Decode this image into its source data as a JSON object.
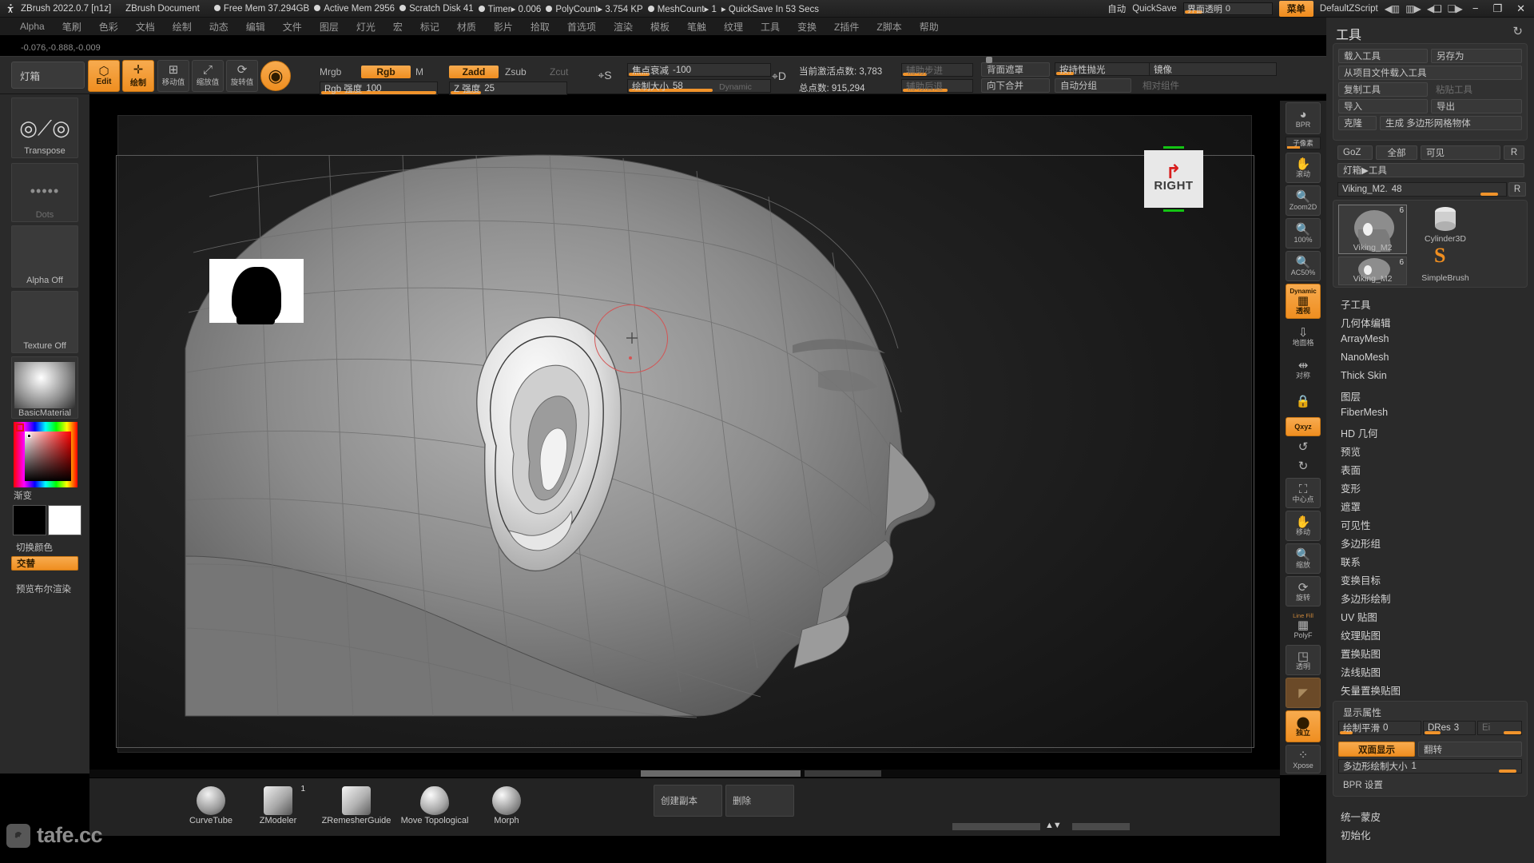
{
  "titlebar": {
    "app_icon": "zbrush-logo-icon",
    "app_name": "ZBrush 2022.0.7 [n1z]",
    "document": "ZBrush Document",
    "stats": [
      "Free Mem 37.294GB",
      "Active Mem 2956",
      "Scratch Disk 41",
      "Timer▸ 0.006",
      "PolyCount▸ 3.754 KP",
      "MeshCount▸ 1"
    ],
    "quicksave_status": "▸ QuickSave In 53 Secs",
    "auto_label": "自动",
    "quicksave_label": "QuickSave",
    "ui_transparency_label": "界面透明",
    "ui_transparency_value": "0",
    "menu_button": "菜单",
    "zscript": "DefaultZScript",
    "window_buttons": [
      "−",
      "❐",
      "✕"
    ]
  },
  "menubar": {
    "items": [
      "Alpha",
      "笔刷",
      "色彩",
      "文档",
      "绘制",
      "动态",
      "编辑",
      "文件",
      "图层",
      "灯光",
      "宏",
      "标记",
      "材质",
      "影片",
      "拾取",
      "首选项",
      "渲染",
      "模板",
      "笔触",
      "纹理",
      "工具",
      "变换",
      "Z插件",
      "Z脚本",
      "帮助"
    ]
  },
  "coord_readout": "-0.076,-0.888,-0.009",
  "topshelf": {
    "lightbox_label": "灯箱",
    "edit_button": "Edit",
    "draw_button": "绘制",
    "move_button": "移动值",
    "scale_button": "缩放值",
    "rotate_button": "旋转值",
    "mrgb": "Mrgb",
    "rgb": "Rgb",
    "m": "M",
    "rgb_intensity_label": "Rgb 强度",
    "rgb_intensity_value": "100",
    "zadd": "Zadd",
    "zsub": "Zsub",
    "zcut": "Zcut",
    "z_intensity_label": "Z 强度",
    "z_intensity_value": "25",
    "focal_shift_label": "焦点衰减",
    "focal_shift_value": "-100",
    "draw_size_label": "绘制大小",
    "draw_size_value": "58",
    "dynamic_label": "Dynamic",
    "active_points_label": "当前激活点数:",
    "active_points_value": "3,783",
    "total_points_label": "总点数:",
    "total_points_value": "915,294",
    "step_forward": "辅助步进",
    "step_back": "辅助后退",
    "backface_mask": "背面遮罩",
    "merge_down": "向下合并",
    "polish_label": "按持性抛光",
    "auto_group": "自动分组",
    "mirror_label": "镜像",
    "align_label": "相对组件"
  },
  "leftshelf": {
    "transpose_label": "Transpose",
    "stroke_label": "Dots",
    "alpha_label": "Alpha Off",
    "texture_label": "Texture Off",
    "material_label": "BasicMaterial",
    "gradient_label": "渐变",
    "switch_color_label": "切换颜色",
    "alternate_label": "交替",
    "boolean_preview_label": "预览布尔渲染"
  },
  "canvas": {
    "nav_cube_label": "RIGHT",
    "nav_cube_icon": "rotate-arrow-icon",
    "ref_image_name": "head-silhouette-reference"
  },
  "right_strip": {
    "items": [
      {
        "label": "BPR",
        "icon": "bpr-render-icon",
        "active": false
      },
      {
        "label": "子像素",
        "icon": "subpixel-slider",
        "slider": true
      },
      {
        "label": "滚动",
        "icon": "scroll-hand-icon",
        "active": false
      },
      {
        "label": "Zoom2D",
        "icon": "zoom2d-icon",
        "active": false
      },
      {
        "label": "100%",
        "icon": "actual-size-icon",
        "active": false
      },
      {
        "label": "AC50%",
        "icon": "aahalf-icon",
        "active": false
      },
      {
        "label": "透视",
        "icon": "perspective-icon",
        "active": true,
        "badge": "Dynamic"
      },
      {
        "label": "地面格",
        "icon": "floor-grid-icon",
        "active": false
      },
      {
        "label": "对称",
        "icon": "symmetry-icon",
        "active": false
      },
      {
        "label": "",
        "icon": "lock-icon",
        "active": false
      },
      {
        "label": "Qxyz",
        "icon": "quick-xyz-icon",
        "active": true
      },
      {
        "label": "",
        "icon": "rotate-y-icon",
        "active": false
      },
      {
        "label": "",
        "icon": "rotate-z-icon",
        "active": false
      },
      {
        "label": "中心点",
        "icon": "frame-icon",
        "active": false
      },
      {
        "label": "移动",
        "icon": "move-hand-icon",
        "active": false
      },
      {
        "label": "缩放",
        "icon": "scale-zoom-icon",
        "active": false
      },
      {
        "label": "旋转",
        "icon": "rotate-icon",
        "active": false
      },
      {
        "label": "PolyF",
        "icon": "polyframe-icon",
        "active": false,
        "badge": "Line Fill"
      },
      {
        "label": "透明",
        "icon": "transparency-icon",
        "active": false
      },
      {
        "label": "",
        "icon": "ghost-transparency-icon",
        "active": false
      },
      {
        "label": "独立",
        "icon": "solo-icon",
        "active": true
      },
      {
        "label": "Xpose",
        "icon": "xpose-icon",
        "active": false
      }
    ]
  },
  "rightpanel": {
    "title": "工具",
    "refresh_icon": "refresh-icon",
    "buttons": {
      "load_tool": "载入工具",
      "save_as": "另存为",
      "load_from_project": "从项目文件载入工具",
      "copy_tool": "复制工具",
      "paste_tool": "粘贴工具",
      "import": "导入",
      "export": "导出",
      "clone": "克隆",
      "make_polymesh": "生成 多边形网格物体",
      "goz": "GoZ",
      "all": "全部",
      "visible": "可见",
      "r": "R",
      "lightbox_tool": "灯箱▶工具"
    },
    "item_slider": {
      "label": "Viking_M2.",
      "value": "48",
      "r_label": "R"
    },
    "thumbs": [
      {
        "name": "Viking_M2",
        "count": "6",
        "icon": "head-mesh-thumb",
        "selected": true
      },
      {
        "name": "Viking_M2",
        "count": "6",
        "icon": "head-mesh-thumb",
        "selected": false
      },
      {
        "name": "Cylinder3D",
        "count": "",
        "icon": "cylinder-3d-icon",
        "selected": false
      },
      {
        "name": "SimpleBrush",
        "count": "",
        "icon": "simplebrush-icon",
        "selected": false
      }
    ],
    "subpalettes": [
      "子工具",
      "几何体编辑",
      "ArrayMesh",
      "NanoMesh",
      "Thick Skin",
      "图层",
      "FiberMesh",
      "HD 几何",
      "预览",
      "表面",
      "变形",
      "遮罩",
      "可见性",
      "多边形组",
      "联系",
      "变换目标",
      "多边形绘制",
      "UV 贴图",
      "纹理贴图",
      "置换贴图",
      "法线贴图",
      "矢量置换贴图"
    ],
    "display_properties": {
      "header": "显示属性",
      "smooth_label": "绘制平滑",
      "smooth_value": "0",
      "dres_label": "DRes",
      "dres_value": "3",
      "ei_label": "Ei",
      "double_sided": "双面显示",
      "flip": "翻转",
      "polypaint_size_label": "多边形绘制大小",
      "polypaint_size_value": "1",
      "bpr_settings": "BPR 设置"
    },
    "footer_items": [
      "统一蒙皮",
      "初始化"
    ]
  },
  "tray": {
    "brushes": [
      {
        "name": "CurveTube",
        "icon": "curvetube-brush-icon",
        "badge": ""
      },
      {
        "name": "ZModeler",
        "icon": "zmodeler-brush-icon",
        "badge": "1"
      },
      {
        "name": "ZRemesherGuide",
        "icon": "zremesherguide-brush-icon",
        "badge": ""
      },
      {
        "name": "Move Topological",
        "icon": "move-topological-brush-icon",
        "badge": ""
      },
      {
        "name": "Morph",
        "icon": "morph-brush-icon",
        "badge": ""
      }
    ],
    "create_copy": "创建副本",
    "delete": "删除"
  },
  "watermark": {
    "text": "tafe.cc",
    "icon": "tafe-logo-icon"
  },
  "colors": {
    "accent": "#ef8e20",
    "panel": "#2a2a2a",
    "canvas": "#000000",
    "brush_ring": "#d45454"
  }
}
